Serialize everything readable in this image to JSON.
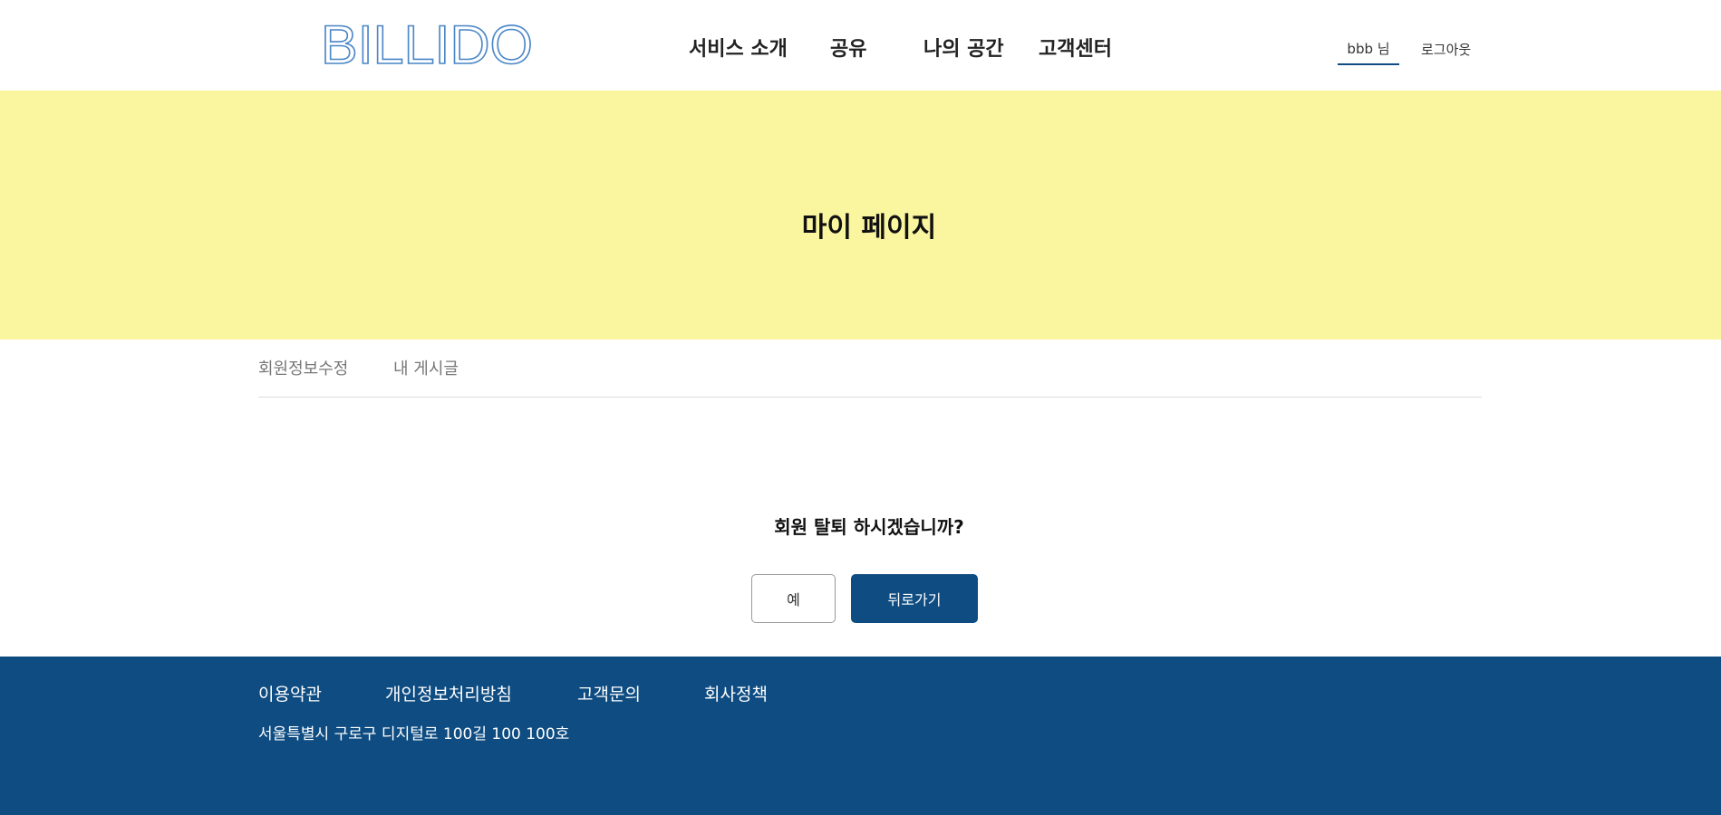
{
  "header": {
    "logo_text": "BILLIDO",
    "nav": [
      {
        "label": "서비스 소개"
      },
      {
        "label": "공유"
      },
      {
        "label": "나의 공간"
      },
      {
        "label": "고객센터"
      }
    ],
    "user_name": "bbb 님",
    "logout_label": "로그아웃"
  },
  "banner": {
    "title": "마이 페이지"
  },
  "tabs": [
    {
      "label": "회원정보수정"
    },
    {
      "label": "내 게시글"
    }
  ],
  "withdraw": {
    "question": "회원 탈퇴 하시겠습니까?",
    "yes_label": "예",
    "back_label": "뒤로가기"
  },
  "footer": {
    "links": [
      {
        "label": "이용약관"
      },
      {
        "label": "개인정보처리방침"
      },
      {
        "label": "고객문의"
      },
      {
        "label": "회사정책"
      }
    ],
    "address": "서울특별시 구로구 디지털로 100길 100 100호"
  },
  "colors": {
    "primary": "#0e4c82",
    "banner_bg": "#faf59f",
    "logo": "#4a86c8"
  }
}
